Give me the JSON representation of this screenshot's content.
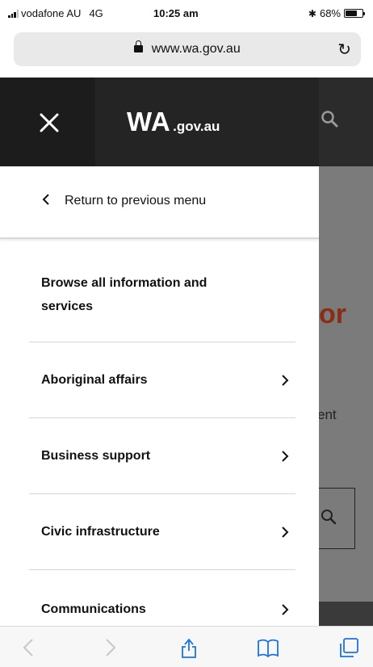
{
  "status_bar": {
    "carrier": "vodafone AU",
    "network": "4G",
    "time": "10:25 am",
    "bluetooth": "✱",
    "battery_percent": "68%",
    "battery_level": 0.68
  },
  "address_bar": {
    "url": "www.wa.gov.au"
  },
  "header": {
    "logo_main": "WA",
    "logo_suffix": ".gov.au"
  },
  "background_page": {
    "title_fragment": "or",
    "text_fragment": "ent"
  },
  "menu": {
    "return_label": "Return to previous menu",
    "browse_label": "Browse all information and services",
    "items": [
      {
        "label": "Aboriginal affairs"
      },
      {
        "label": "Business support"
      },
      {
        "label": "Civic infrastructure"
      },
      {
        "label": "Communications"
      }
    ]
  },
  "colors": {
    "header_dark": "#242424",
    "overlay_gray": "#7b7b7b",
    "title_accent": "#8a2c16"
  }
}
